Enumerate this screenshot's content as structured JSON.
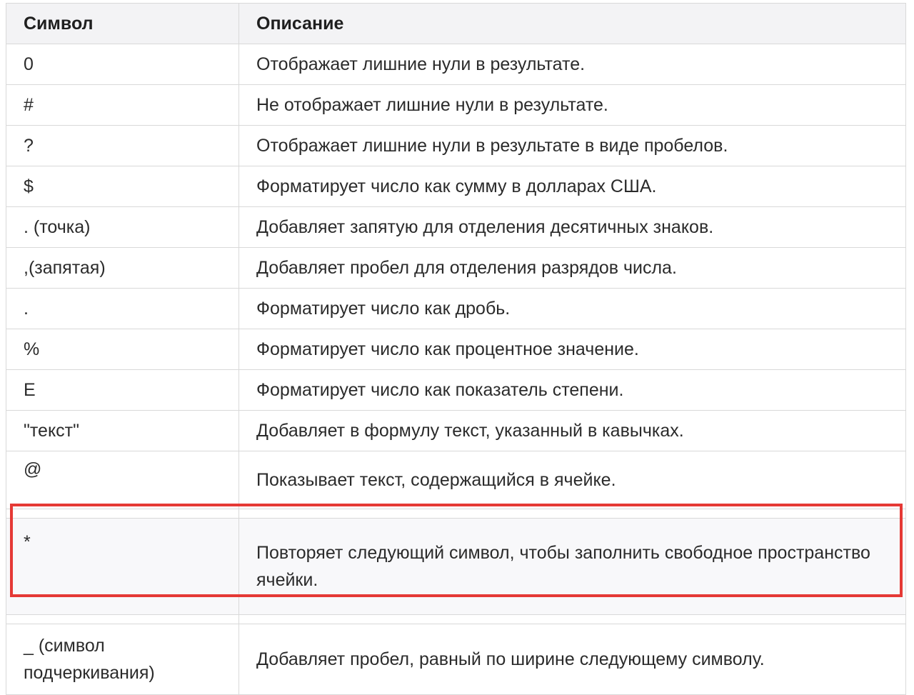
{
  "table": {
    "headers": [
      "Символ",
      "Описание"
    ],
    "rows": [
      {
        "symbol": "0",
        "description": "Отображает лишние нули в результате."
      },
      {
        "symbol": "#",
        "description": "Не отображает лишние нули в результате."
      },
      {
        "symbol": "?",
        "description": "Отображает лишние нули в результате в виде пробелов."
      },
      {
        "symbol": "$",
        "description": "Форматирует число как сумму в долларах США."
      },
      {
        "symbol": ". (точка)",
        "description": "Добавляет запятую для отделения десятичных знаков."
      },
      {
        "symbol": ",(запятая)",
        "description": "Добавляет пробел для отделения разрядов числа."
      },
      {
        "symbol": ".",
        "description": "Форматирует число как дробь."
      },
      {
        "symbol": "%",
        "description": "Форматирует число как процентное значение."
      },
      {
        "symbol": "E",
        "description": "Форматирует число как показатель степени."
      },
      {
        "symbol": "\"текст\"",
        "description": "Добавляет в формулу текст, указанный в кавычках."
      },
      {
        "symbol": "@",
        "description": "Показывает текст, содержащийся в ячейке."
      },
      {
        "symbol": "*",
        "description": "Повторяет следующий символ, чтобы заполнить свободное пространство ячейки."
      },
      {
        "symbol": "_ (символ подчеркивания)",
        "description": "Добавляет пробел, равный по ширине следующему символу."
      }
    ]
  },
  "highlight": {
    "row_index": 11,
    "color": "#e53935"
  }
}
